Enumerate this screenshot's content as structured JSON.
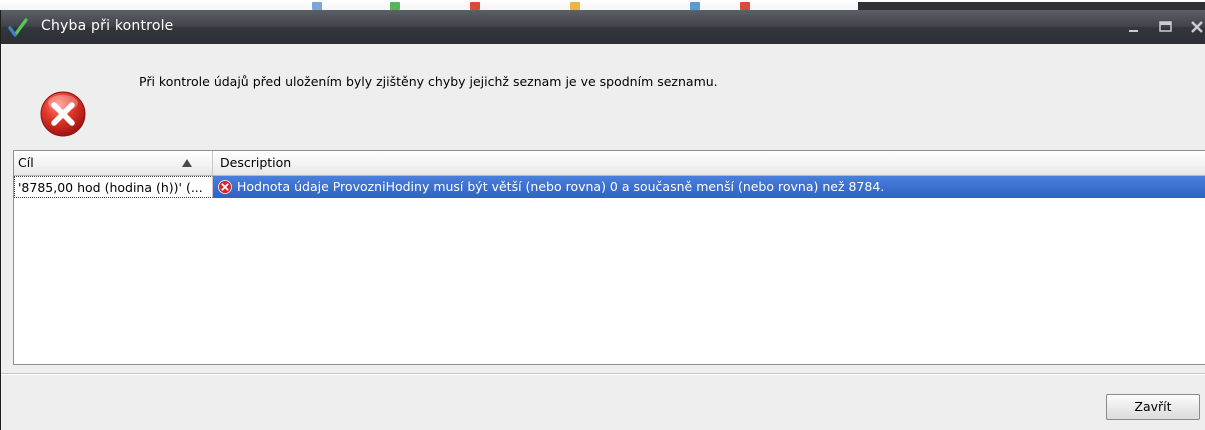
{
  "window": {
    "title": "Chyba při kontrole",
    "controls": [
      "minimize-icon",
      "maximize-icon",
      "close-icon"
    ]
  },
  "message": "Při kontrole údajů před uložením byly zjištěny chyby jejichž seznam je ve spodním seznamu.",
  "icons": {
    "app": "checkmark-icon",
    "dialog": "error-icon",
    "row": "error-small-icon"
  },
  "grid": {
    "columns": [
      {
        "label": "Cíl",
        "sort": "ascending"
      },
      {
        "label": "Description"
      }
    ],
    "rows": [
      {
        "target": "'8785,00 hod (hodina (h))' (...",
        "description": "Hodnota údaje ProvozniHodiny musí být větší (nebo rovna) 0 a současně menší (nebo rovna) než 8784.",
        "selected": true
      }
    ]
  },
  "buttons": {
    "close_label": "Zavřít"
  },
  "colors": {
    "titlebar": "#33363b",
    "selection": "#3a6fcf",
    "error_red": "#d9262b",
    "dialog_bg": "#eeeeee"
  }
}
